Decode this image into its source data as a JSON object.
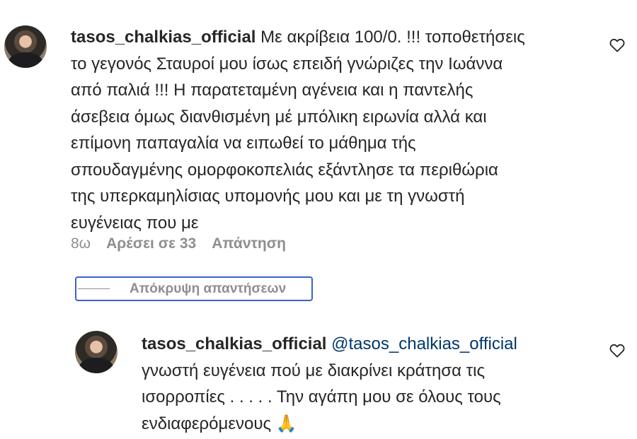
{
  "comments": [
    {
      "username": "tasos_chalkias_official",
      "lines": [
        "Με ακρίβεια 100/0. !!! τοποθετήσεις",
        "το γεγονός Σταυροί μου ίσως επειδή γνώριζες την Ιωάννα",
        "από παλιά !!! Η παρατεταμένη αγένεια και η παντελής",
        "άσεβεια όμως διανθισμένη μέ μπόλικη ειρωνία αλλά και",
        "επίμονη παπαγαλία να ειπωθεί το μάθημα τής",
        "σπουδαγμένης ομορφοκοπελιάς εξάντλησε τα περιθώρια",
        "της υπερκαμηλίσιας υπομονής μου και με τη γνωστή",
        "ευγένειας που με"
      ],
      "time": "8ω",
      "likes": "Αρέσει σε 33",
      "reply": "Απάντηση",
      "heart_icon": "heart-outline-icon"
    }
  ],
  "hide_replies": "Απόκρυψη απαντήσεων",
  "reply_comment": {
    "username": "tasos_chalkias_official",
    "mention": "@tasos_chalkias_official",
    "lines": [
      "γνωστή ευγένεια πού με διακρίνει κράτησα τις",
      "ισορροπίες . . . . . Την αγάπη μου σε όλους τους",
      "ενδιαφερόμενους 🙏"
    ],
    "heart_icon": "heart-outline-icon"
  }
}
